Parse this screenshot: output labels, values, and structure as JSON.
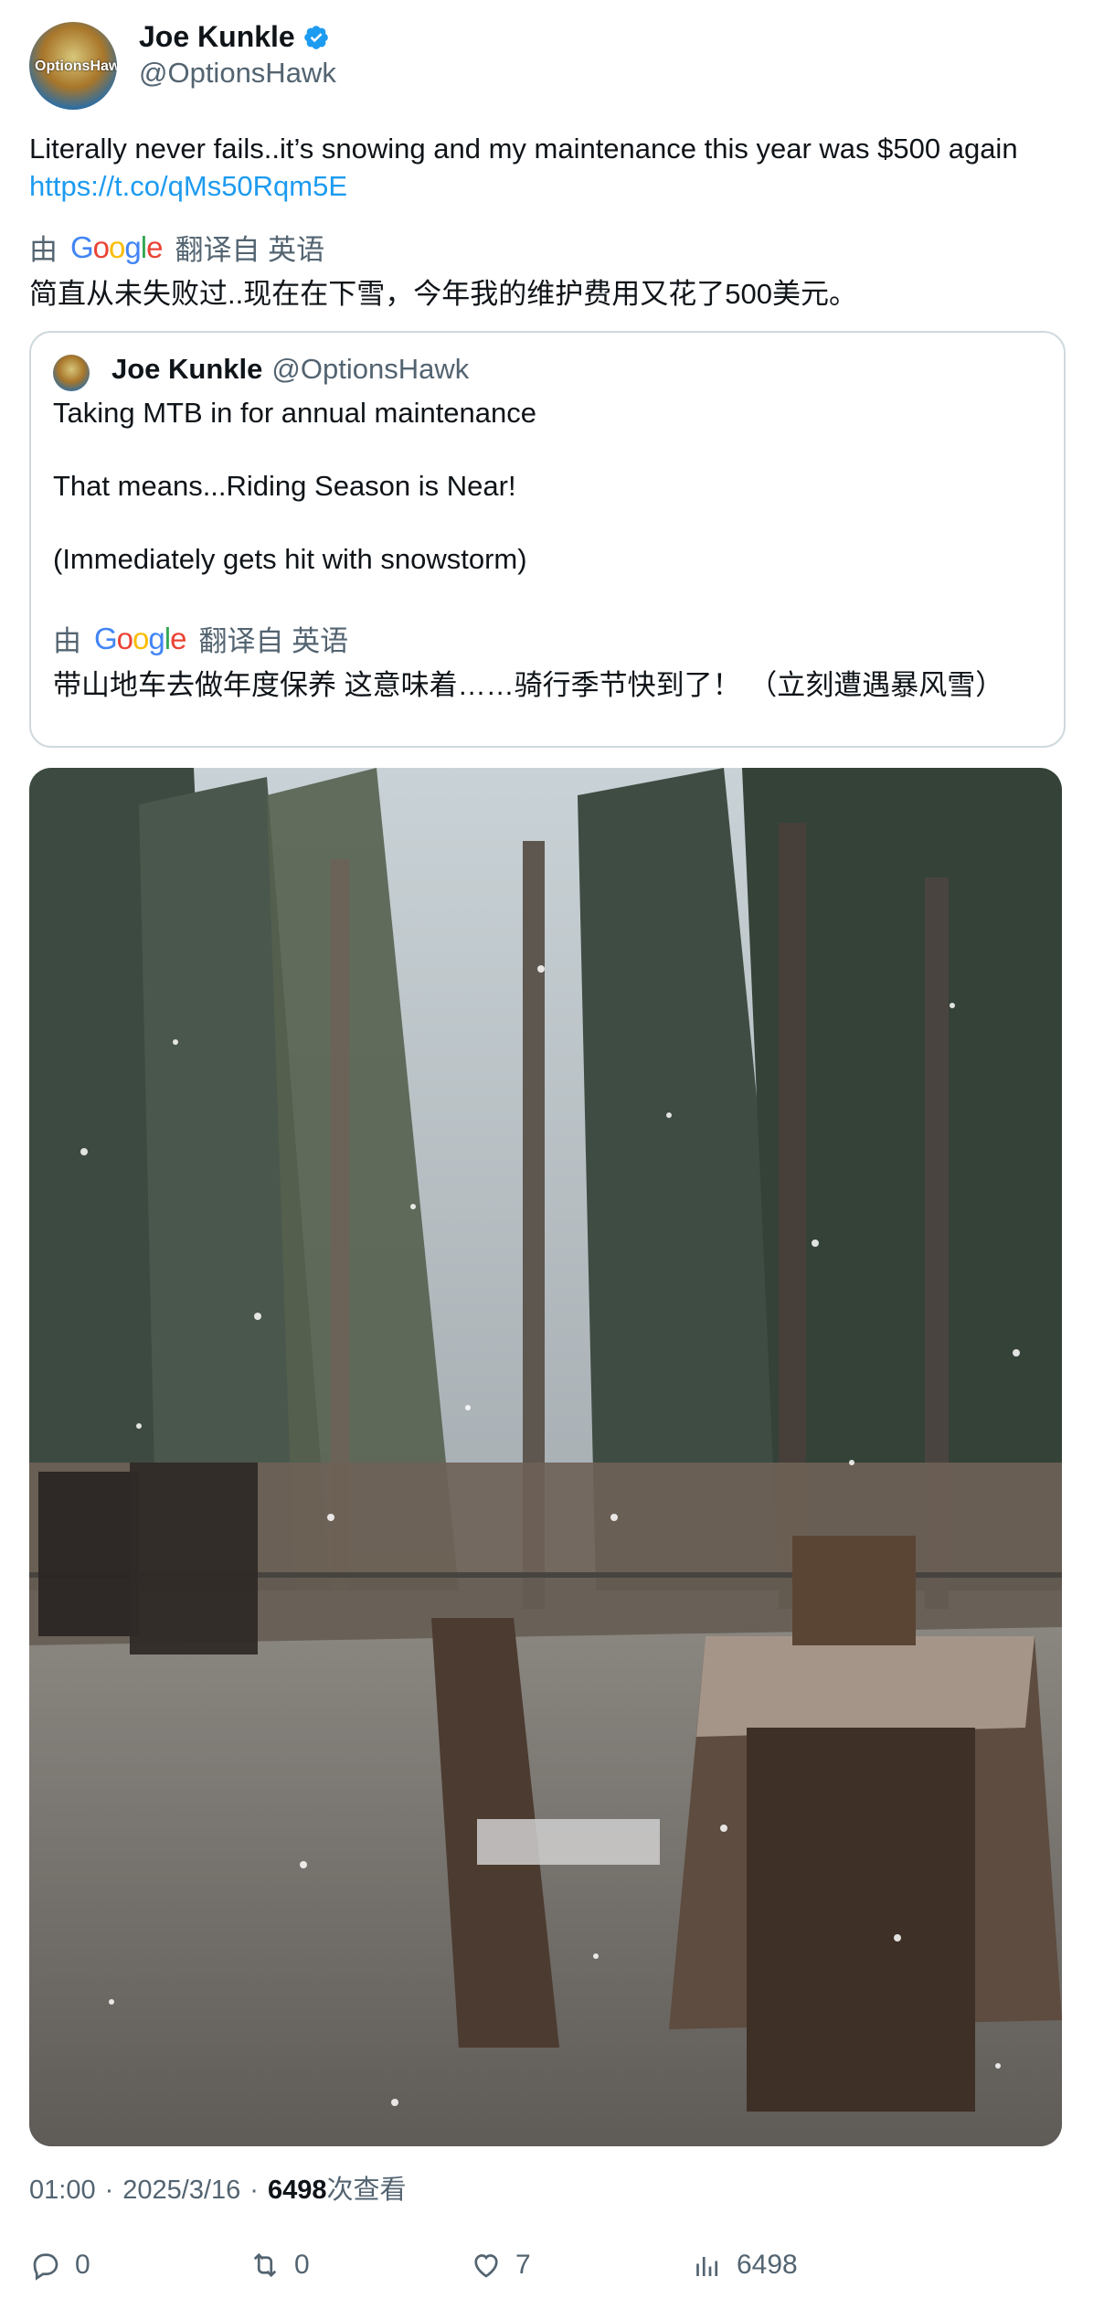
{
  "author": {
    "name": "Joe Kunkle",
    "handle": "@OptionsHawk",
    "avatar_text": "OptionsHawk"
  },
  "tweet": {
    "text": "Literally never fails..it’s snowing and my maintenance this year was $500 again",
    "link": "https://t.co/qMs50Rqm5E"
  },
  "translation": {
    "by": "由",
    "translated_from": "翻译自 英语",
    "text": "简直从未失败过..现在在下雪，今年我的维护费用又花了500美元。"
  },
  "quote": {
    "name": "Joe Kunkle",
    "handle": "@OptionsHawk",
    "line1": "Taking MTB in for annual maintenance",
    "line2": "That means...Riding Season is Near!",
    "line3": "(Immediately gets hit with snowstorm)",
    "translation_by": "由",
    "translated_from": "翻译自 英语",
    "translation_text": "带山地车去做年度保养 这意味着……骑行季节快到了！ （立刻遭遇暴风雪）"
  },
  "meta": {
    "time": "01:00",
    "date": "2025/3/16",
    "views": "6498",
    "views_label": "次查看",
    "sep": "·"
  },
  "actions": {
    "replies": "0",
    "retweets": "0",
    "likes": "7",
    "views": "6498"
  },
  "colors": {
    "link": "#1d9bf0",
    "secondary": "#536471",
    "verified": "#1d9bf0",
    "border": "#cfd9de"
  }
}
